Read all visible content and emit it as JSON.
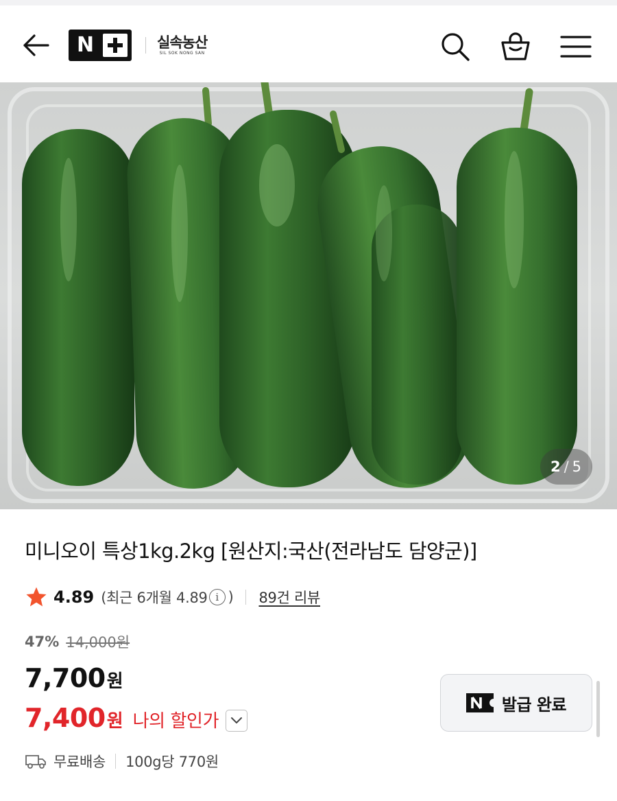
{
  "header": {
    "logo_text": "N+",
    "brand_name": "실속농산",
    "brand_sub": "SIL SOK NONG SAN",
    "icons": [
      "back-arrow-icon",
      "search-icon",
      "shopping-bag-icon",
      "hamburger-menu-icon"
    ]
  },
  "gallery": {
    "current": "2",
    "separator": "/",
    "total": "5"
  },
  "product": {
    "title": "미니오이 특상1kg.2kg [원산지:국산(전라남도 담양군)]",
    "rating": "4.89",
    "recent_rating": "(최근 6개월 4.89",
    "info_icon_char": "i",
    "recent_close": ")",
    "reviews": "89건 리뷰",
    "discount_rate": "47%",
    "original_price": "14,000원",
    "price": "7,700",
    "currency": "원",
    "my_price": "7,400",
    "my_currency": "원",
    "my_price_label": "나의 할인가",
    "coupon_label": "발급 완료",
    "shipping": "무료배송",
    "unit_price": "100g당 770원"
  },
  "colors": {
    "accent_red": "#e1252a",
    "star_orange": "#f2542d",
    "text_primary": "#111111"
  }
}
